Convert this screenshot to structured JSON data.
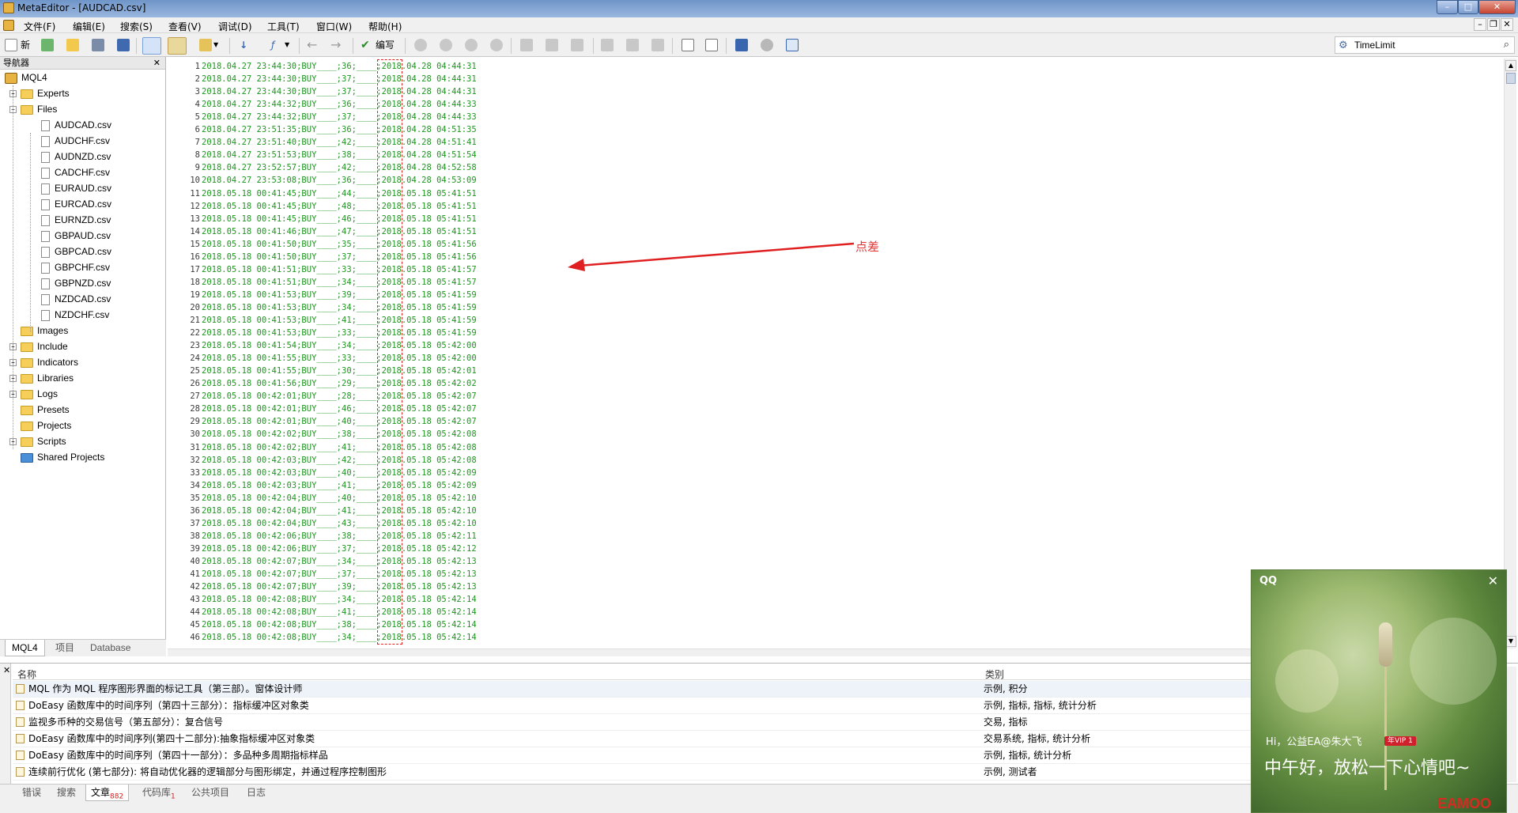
{
  "window": {
    "title": "MetaEditor - [AUDCAD.csv]",
    "min": "–",
    "max": "□",
    "close": "✕"
  },
  "menu": {
    "items": [
      "文件(F)",
      "编辑(E)",
      "搜索(S)",
      "查看(V)",
      "调试(D)",
      "工具(T)",
      "窗口(W)",
      "帮助(H)"
    ],
    "mdi": [
      "–",
      "❐",
      "✕"
    ]
  },
  "toolbar": {
    "new_label": "新",
    "compile_label": "编写",
    "search_value": "TimeLimit"
  },
  "navigator": {
    "title": "导航器",
    "close": "✕",
    "root": "MQL4",
    "folders_top": [
      "Experts",
      "Files"
    ],
    "files": [
      "AUDCAD.csv",
      "AUDCHF.csv",
      "AUDNZD.csv",
      "CADCHF.csv",
      "EURAUD.csv",
      "EURCAD.csv",
      "EURNZD.csv",
      "GBPAUD.csv",
      "GBPCAD.csv",
      "GBPCHF.csv",
      "GBPNZD.csv",
      "NZDCAD.csv",
      "NZDCHF.csv"
    ],
    "folders_bottom": [
      "Images",
      "Include",
      "Indicators",
      "Libraries",
      "Logs",
      "Presets",
      "Projects",
      "Scripts",
      "Shared Projects"
    ],
    "tabs": [
      "MQL4",
      "项目",
      "Database"
    ]
  },
  "editor": {
    "lines": [
      "2018.04.27 23:44:30;BUY____;36;____;2018.04.28 04:44:31",
      "2018.04.27 23:44:30;BUY____;37;____;2018.04.28 04:44:31",
      "2018.04.27 23:44:30;BUY____;37;____;2018.04.28 04:44:31",
      "2018.04.27 23:44:32;BUY____;36;____;2018.04.28 04:44:33",
      "2018.04.27 23:44:32;BUY____;37;____;2018.04.28 04:44:33",
      "2018.04.27 23:51:35;BUY____;36;____;2018.04.28 04:51:35",
      "2018.04.27 23:51:40;BUY____;42;____;2018.04.28 04:51:41",
      "2018.04.27 23:51:53;BUY____;38;____;2018.04.28 04:51:54",
      "2018.04.27 23:52:57;BUY____;42;____;2018.04.28 04:52:58",
      "2018.04.27 23:53:08;BUY____;36;____;2018.04.28 04:53:09",
      "2018.05.18 00:41:45;BUY____;44;____;2018.05.18 05:41:51",
      "2018.05.18 00:41:45;BUY____;48;____;2018.05.18 05:41:51",
      "2018.05.18 00:41:45;BUY____;46;____;2018.05.18 05:41:51",
      "2018.05.18 00:41:46;BUY____;47;____;2018.05.18 05:41:51",
      "2018.05.18 00:41:50;BUY____;35;____;2018.05.18 05:41:56",
      "2018.05.18 00:41:50;BUY____;37;____;2018.05.18 05:41:56",
      "2018.05.18 00:41:51;BUY____;33;____;2018.05.18 05:41:57",
      "2018.05.18 00:41:51;BUY____;34;____;2018.05.18 05:41:57",
      "2018.05.18 00:41:53;BUY____;39;____;2018.05.18 05:41:59",
      "2018.05.18 00:41:53;BUY____;34;____;2018.05.18 05:41:59",
      "2018.05.18 00:41:53;BUY____;41;____;2018.05.18 05:41:59",
      "2018.05.18 00:41:53;BUY____;33;____;2018.05.18 05:41:59",
      "2018.05.18 00:41:54;BUY____;34;____;2018.05.18 05:42:00",
      "2018.05.18 00:41:55;BUY____;33;____;2018.05.18 05:42:00",
      "2018.05.18 00:41:55;BUY____;30;____;2018.05.18 05:42:01",
      "2018.05.18 00:41:56;BUY____;29;____;2018.05.18 05:42:02",
      "2018.05.18 00:42:01;BUY____;28;____;2018.05.18 05:42:07",
      "2018.05.18 00:42:01;BUY____;46;____;2018.05.18 05:42:07",
      "2018.05.18 00:42:01;BUY____;40;____;2018.05.18 05:42:07",
      "2018.05.18 00:42:02;BUY____;38;____;2018.05.18 05:42:08",
      "2018.05.18 00:42:02;BUY____;41;____;2018.05.18 05:42:08",
      "2018.05.18 00:42:03;BUY____;42;____;2018.05.18 05:42:08",
      "2018.05.18 00:42:03;BUY____;40;____;2018.05.18 05:42:09",
      "2018.05.18 00:42:03;BUY____;41;____;2018.05.18 05:42:09",
      "2018.05.18 00:42:04;BUY____;40;____;2018.05.18 05:42:10",
      "2018.05.18 00:42:04;BUY____;41;____;2018.05.18 05:42:10",
      "2018.05.18 00:42:04;BUY____;43;____;2018.05.18 05:42:10",
      "2018.05.18 00:42:06;BUY____;38;____;2018.05.18 05:42:11",
      "2018.05.18 00:42:06;BUY____;37;____;2018.05.18 05:42:12",
      "2018.05.18 00:42:07;BUY____;34;____;2018.05.18 05:42:13",
      "2018.05.18 00:42:07;BUY____;37;____;2018.05.18 05:42:13",
      "2018.05.18 00:42:07;BUY____;39;____;2018.05.18 05:42:13",
      "2018.05.18 00:42:08;BUY____;34;____;2018.05.18 05:42:14",
      "2018.05.18 00:42:08;BUY____;41;____;2018.05.18 05:42:14",
      "2018.05.18 00:42:08;BUY____;38;____;2018.05.18 05:42:14",
      "2018.05.18 00:42:08;BUY____;34;____;2018.05.18 05:42:14"
    ],
    "annotation": "点差"
  },
  "toolbox": {
    "close": "✕",
    "columns": {
      "name": "名称",
      "category": "类别"
    },
    "articles": [
      {
        "name": "MQL 作为 MQL 程序图形界面的标记工具（第三部）。窗体设计师",
        "category": "示例, 积分"
      },
      {
        "name": "DoEasy 函数库中的时间序列（第四十三部分）：指标缓冲区对象类",
        "category": "示例, 指标, 指标, 统计分析"
      },
      {
        "name": "监视多币种的交易信号（第五部分）：复合信号",
        "category": "交易, 指标"
      },
      {
        "name": "DoEasy 函数库中的时间序列(第四十二部分):抽象指标缓冲区对象类",
        "category": "交易系统, 指标, 统计分析"
      },
      {
        "name": "DoEasy 函数库中的时间序列（第四十一部分）：多品种多周期指标样品",
        "category": "示例, 指标, 统计分析"
      },
      {
        "name": "连续前行优化 (第七部分): 将自动优化器的逻辑部分与图形绑定，并通过程序控制图形",
        "category": "示例, 测试者"
      }
    ],
    "tabs": [
      "错误",
      "搜索",
      "文章",
      "代码库",
      "公共项目",
      "日志"
    ],
    "articles_count": "882",
    "codebase_count": "1"
  },
  "qq": {
    "brand": "QQ",
    "close": "✕",
    "greeting_name": "Hi，公益EA@朱大飞",
    "vip_badge": "年VIP 1",
    "message": "中午好，放松一下心情吧~"
  },
  "watermark": "EAMOO",
  "colors": {
    "code_text": "#1e9620",
    "annotation": "#e53232",
    "title_bar": "#7c9cce"
  }
}
